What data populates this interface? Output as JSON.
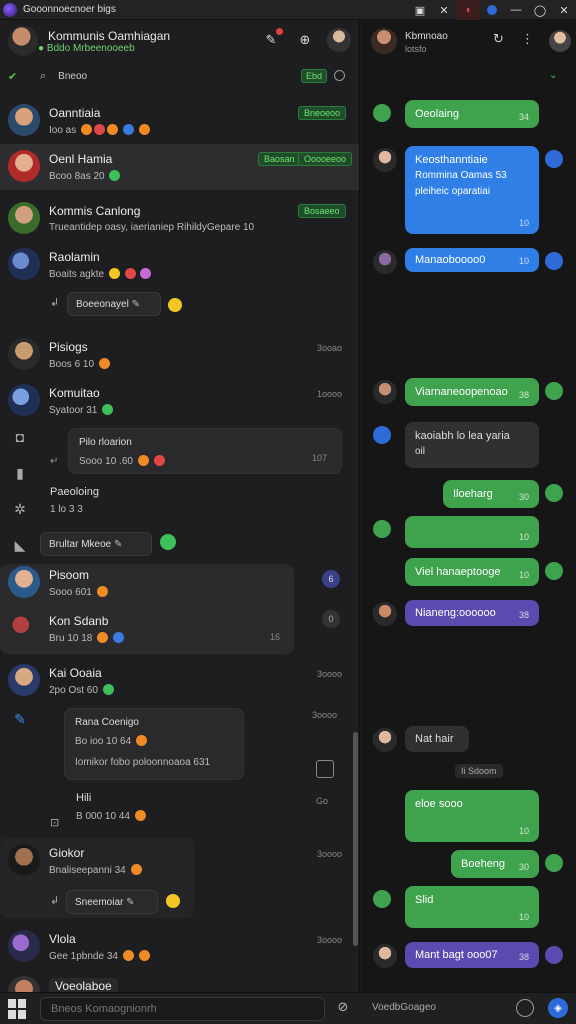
{
  "window": {
    "title": "Gooonnoecnoer bigs"
  },
  "left_header": {
    "title": "Kommunis Oamhiagan",
    "subtitle": "● Bddo Mrbeenooeeb"
  },
  "search": {
    "value": "Bneoo",
    "tag": "Ebd"
  },
  "chats": [
    {
      "name": "Oanntiaia",
      "preview": "Ioo as",
      "tag": "Bneoeoo",
      "time": ""
    },
    {
      "name": "Oenl Hamia",
      "preview": "Bcoo 8as 20",
      "tag": "Baosan",
      "tag2": "Ooooeeoo",
      "time": ""
    },
    {
      "name": "Kommis Canlong",
      "preview": "Trueantidep oasy, iaerianiep RihildyGepare 10",
      "tag": "Bosaeeo",
      "time": ""
    },
    {
      "name": "Raolamin",
      "preview": "Boaits agkte",
      "time": ""
    },
    {
      "name": "Pisiogs",
      "preview": "Boos 6 10",
      "time": "3ooao"
    },
    {
      "name": "Komuitao",
      "preview": "Syatoor 31",
      "time": "1oooo"
    },
    {
      "name": "Pisoom",
      "preview": "Sooo 601",
      "time": ""
    },
    {
      "name": "Kon Sdanb",
      "preview": "Bru 10 18",
      "time": "16"
    },
    {
      "name": "Kai Ooaia",
      "preview": "2po Ost 60",
      "time": "3oooo"
    },
    {
      "name": "Giokor",
      "preview": "Bnaliseepanni 34",
      "time": "3oooo"
    },
    {
      "name": "Vlola",
      "preview": "Gee 1pbnde 34",
      "time": "3oooo"
    },
    {
      "name": "Voeolaboe",
      "preview": "",
      "time": ""
    }
  ],
  "pills": {
    "p1": "Boeeonayel",
    "p2": "Brultar Mkeoe",
    "p3": "Sneemoiar"
  },
  "cards": {
    "c1": {
      "title": "Pilo rloarion",
      "line": "Sooo 10 .60",
      "time": "107"
    },
    "c2": {
      "title": "Paeoloing",
      "line": "1 lo 3 3"
    },
    "c3": {
      "title": "Rana Coenigo",
      "line1": "Bo ioo 10 64",
      "line2": "Iomikor fobo poloonnoaoa  631"
    },
    "c4": {
      "title": "Hili",
      "line": "B 000 10 44",
      "time": "Go"
    }
  },
  "badges": {
    "b1": "6",
    "b2": "0"
  },
  "composer": {
    "placeholder": "Bneos Komaognionrh"
  },
  "right_header": {
    "name": "Kbmnoao",
    "sub": "lotsfo"
  },
  "right_status": "VoedbGoageo",
  "messages": [
    {
      "text": "Oeolaing",
      "time": "34",
      "kind": "green"
    },
    {
      "text": "Keosthanntiaie",
      "text2": "Rommina Oamas  53",
      "text3": "pleiheic oparatiai",
      "time": "10",
      "kind": "blue"
    },
    {
      "text": "Manaoboooo0",
      "time": "10",
      "kind": "blue"
    },
    {
      "text": "Viarnaneoopenoao",
      "time": "38",
      "kind": "green"
    },
    {
      "text": "kaoiabh lo lea yaria",
      "text2": "oil",
      "kind": "gray"
    },
    {
      "text": "Iloeharg",
      "time": "30",
      "kind": "green"
    },
    {
      "text": "",
      "time": "10",
      "kind": "green"
    },
    {
      "text": "Viel hanaeptooge",
      "time": "10",
      "kind": "green"
    },
    {
      "text": "Nianeng:oooooo",
      "time": "38",
      "kind": "purple"
    },
    {
      "text": "Nat hair",
      "kind": "gray"
    },
    {
      "text": "eloe sooo",
      "time": "10",
      "kind": "green"
    },
    {
      "text": "Boeheng",
      "time": "30",
      "kind": "green"
    },
    {
      "text": "Slid",
      "time": "10",
      "kind": "green"
    },
    {
      "text": "Mant bagt ooo07",
      "time": "38",
      "kind": "purple"
    }
  ],
  "date_separator": "Ii Sdoom",
  "colors": {
    "green": "#3fa34d",
    "blue": "#2f7fe6",
    "purple": "#5b4bb0",
    "accent": "#2f6bd8"
  }
}
